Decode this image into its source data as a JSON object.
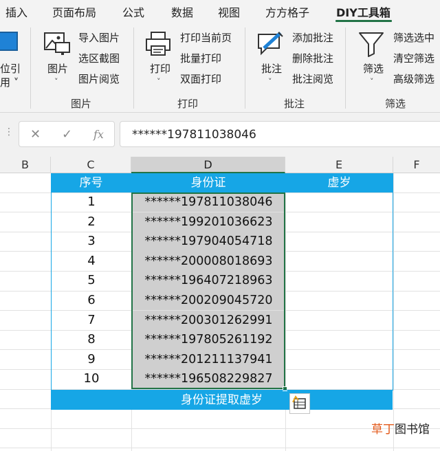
{
  "menu": {
    "tabs": [
      {
        "label": "插入"
      },
      {
        "label": "页面布局"
      },
      {
        "label": "公式"
      },
      {
        "label": "数据"
      },
      {
        "label": "视图"
      },
      {
        "label": "方方格子"
      },
      {
        "label": "DIY工具箱",
        "active": true
      }
    ]
  },
  "ribbon": {
    "partial_group": {
      "label_line1": "位引",
      "label_line2": "用 ˅"
    },
    "picture_group": {
      "big_label": "图片",
      "items": [
        "导入图片",
        "选区截图",
        "图片阅览"
      ],
      "group_label": "图片"
    },
    "print_group": {
      "big_label": "打印",
      "items": [
        "打印当前页",
        "批量打印",
        "双面打印"
      ],
      "group_label": "打印"
    },
    "comment_group": {
      "big_label": "批注",
      "items": [
        "添加批注",
        "删除批注",
        "批注阅览"
      ],
      "group_label": "批注"
    },
    "filter_group": {
      "big_label": "筛选",
      "items": [
        "筛选选中",
        "清空筛选",
        "高级筛选"
      ],
      "group_label": "筛选"
    }
  },
  "formula_bar": {
    "cancel": "✕",
    "confirm": "✓",
    "fx": "fx",
    "value": "******197811038046"
  },
  "columns": [
    "B",
    "C",
    "D",
    "E",
    "F"
  ],
  "selected_column": "D",
  "table": {
    "headers": [
      "序号",
      "身份证",
      "虚岁"
    ],
    "rows": [
      {
        "no": "1",
        "id": "******197811038046",
        "age": ""
      },
      {
        "no": "2",
        "id": "******199201036623",
        "age": ""
      },
      {
        "no": "3",
        "id": "******197904054718",
        "age": ""
      },
      {
        "no": "4",
        "id": "******200008018693",
        "age": ""
      },
      {
        "no": "5",
        "id": "******196407218963",
        "age": ""
      },
      {
        "no": "6",
        "id": "******200209045720",
        "age": ""
      },
      {
        "no": "7",
        "id": "******200301262991",
        "age": ""
      },
      {
        "no": "8",
        "id": "******197805261192",
        "age": ""
      },
      {
        "no": "9",
        "id": "******201211137941",
        "age": ""
      },
      {
        "no": "10",
        "id": "******196508229827",
        "age": ""
      }
    ],
    "footer_banner": "身份证提取虚岁"
  },
  "watermark": {
    "part1": "草丁",
    "part2": "图书馆"
  },
  "colors": {
    "accent": "#217346",
    "table_header": "#16a6e6",
    "selection_fill": "#cfcfcf"
  }
}
